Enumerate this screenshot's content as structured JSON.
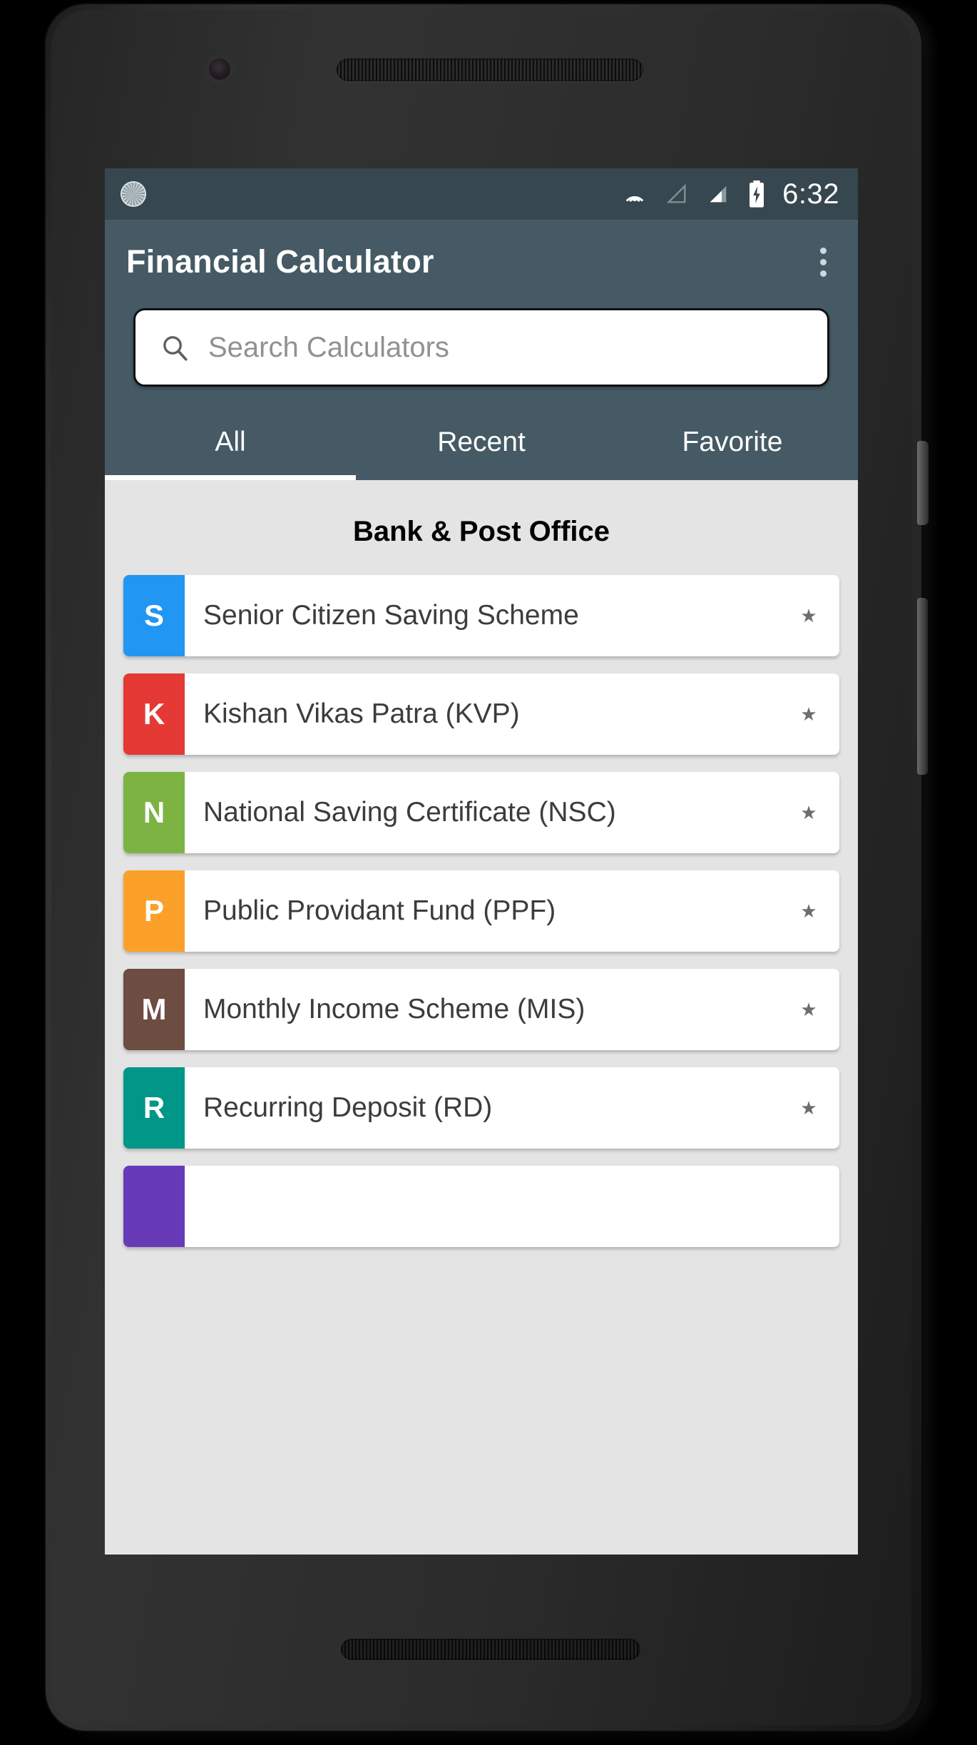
{
  "device": {
    "hardware": {
      "front_camera": "front-camera",
      "earpiece": "earpiece-speaker",
      "bottom_speaker": "bottom-speaker",
      "power_button": "power-button",
      "volume_button": "volume-rocker"
    }
  },
  "status_bar": {
    "left_icon": "updating-sync-icon",
    "icons": [
      "cast-icon",
      "signal-inactive-icon",
      "signal-bars-icon",
      "battery-charging-icon"
    ],
    "time": "6:32",
    "background": "#37474f"
  },
  "app_bar": {
    "title": "Financial Calculator",
    "overflow_icon": "more-vert-icon",
    "background": "#455a64"
  },
  "search": {
    "placeholder": "Search Calculators",
    "icon": "search-icon",
    "value": ""
  },
  "tabs": [
    {
      "label": "All",
      "active": true
    },
    {
      "label": "Recent",
      "active": false
    },
    {
      "label": "Favorite",
      "active": false
    }
  ],
  "content": {
    "section_title": "Bank & Post Office",
    "star_glyph": "★",
    "items": [
      {
        "initial": "S",
        "label": "Senior Citizen Saving Scheme",
        "color": "#2196f3"
      },
      {
        "initial": "K",
        "label": "Kishan Vikas Patra (KVP)",
        "color": "#e53935"
      },
      {
        "initial": "N",
        "label": "National Saving Certificate (NSC)",
        "color": "#7cb342"
      },
      {
        "initial": "P",
        "label": "Public Providant Fund (PPF)",
        "color": "#fba12a"
      },
      {
        "initial": "M",
        "label": "Monthly Income Scheme (MIS)",
        "color": "#6d4c41"
      },
      {
        "initial": "R",
        "label": "Recurring Deposit (RD)",
        "color": "#009688"
      },
      {
        "initial": "",
        "label": "",
        "color": "#673ab7"
      }
    ]
  },
  "nav_bar": {
    "background": "#444f53",
    "buttons": [
      {
        "name": "back-button",
        "icon": "back-triangle-icon"
      },
      {
        "name": "home-button",
        "icon": "home-circle-icon"
      },
      {
        "name": "recents-button",
        "icon": "recents-square-icon"
      }
    ]
  }
}
